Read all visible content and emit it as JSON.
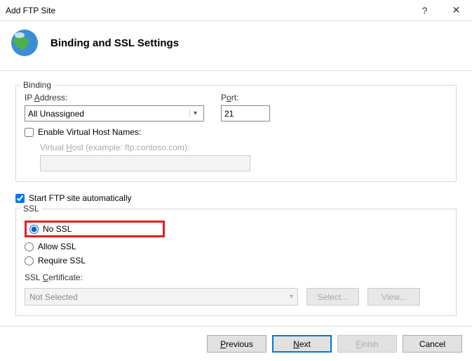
{
  "window": {
    "title": "Add FTP Site",
    "help": "?",
    "close": "✕"
  },
  "page": {
    "title": "Binding and SSL Settings"
  },
  "binding": {
    "legend": "Binding",
    "ip_label_pre": "IP ",
    "ip_label_u": "A",
    "ip_label_post": "ddress:",
    "ip_value": "All Unassigned",
    "port_label_pre": "P",
    "port_label_u": "o",
    "port_label_post": "rt:",
    "port_value": "21",
    "vh_enable_pre": "Enable ",
    "vh_enable_u": "V",
    "vh_enable_post": "irtual Host Names:",
    "vh_label_pre": "Virtual ",
    "vh_label_u": "H",
    "vh_label_post": "ost (example: ftp.contoso.com):"
  },
  "autostart": {
    "checked": true,
    "label": "Start FTP site automatically"
  },
  "ssl": {
    "legend": "SSL",
    "no_ssl_u": "N",
    "no_ssl_post": "o SSL",
    "allow_pre": "A",
    "allow_u": "l",
    "allow_post": "low SSL",
    "require_u": "R",
    "require_post": "equire SSL",
    "cert_label_pre": "SSL ",
    "cert_label_u": "C",
    "cert_label_post": "ertificate:",
    "cert_value": "Not Selected",
    "select_btn_pre": "S",
    "select_btn_u": "e",
    "select_btn_post": "lect...",
    "view_btn_pre": "V",
    "view_btn_u": "i",
    "view_btn_post": "ew..."
  },
  "footer": {
    "previous_u": "P",
    "previous_post": "revious",
    "next_u": "N",
    "next_post": "ext",
    "finish_u": "F",
    "finish_post": "inish",
    "cancel": "Cancel"
  }
}
